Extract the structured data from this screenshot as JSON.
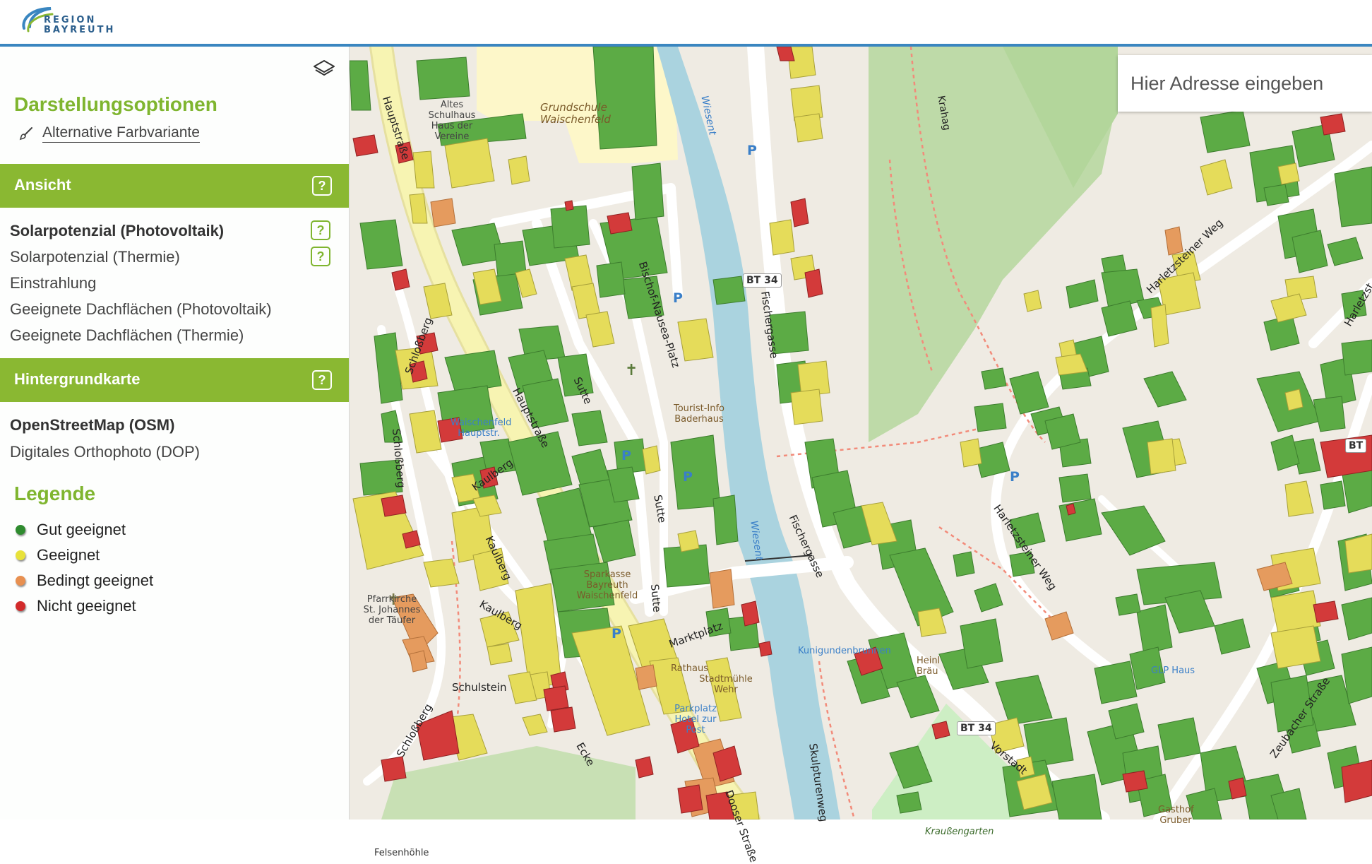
{
  "header": {
    "logo_line1": "REGION",
    "logo_line2": "BAYREUTH"
  },
  "search": {
    "placeholder": "Hier Adresse eingeben"
  },
  "sidebar": {
    "display_title": "Darstellungsoptionen",
    "alt_color_label": "Alternative Farbvariante",
    "view_band": {
      "label": "Ansicht",
      "help": "?"
    },
    "view_options": [
      {
        "label": "Solarpotenzial (Photovoltaik)",
        "active": true,
        "help": "?"
      },
      {
        "label": "Solarpotenzial (Thermie)",
        "active": false,
        "help": "?"
      },
      {
        "label": "Einstrahlung",
        "active": false
      },
      {
        "label": "Geeignete Dachflächen (Photovoltaik)",
        "active": false
      },
      {
        "label": "Geeignete Dachflächen (Thermie)",
        "active": false
      }
    ],
    "basemap_band": {
      "label": "Hintergrundkarte",
      "help": "?"
    },
    "basemap_options": [
      {
        "label": "OpenStreetMap (OSM)",
        "active": true
      },
      {
        "label": "Digitales Orthophoto (DOP)",
        "active": false
      }
    ],
    "legend_title": "Legende",
    "legend": [
      {
        "label": "Gut geeignet",
        "color": "#2e8b2e"
      },
      {
        "label": "Geeignet",
        "color": "#e8e23a"
      },
      {
        "label": "Bedingt geeignet",
        "color": "#e89050"
      },
      {
        "label": "Nicht geeignet",
        "color": "#d22b2b"
      }
    ]
  },
  "map": {
    "colors": {
      "good": "#5cab45",
      "suitable": "#e5dc5a",
      "conditional": "#e59b5e",
      "unsuitable": "#d33a3a",
      "water": "#aad3df",
      "forest": "#b8d9a2",
      "school": "#fdf7c9",
      "road_main": "#f7f4b2"
    },
    "road_labels": [
      "Hauptstraße",
      "Schloßberg",
      "Kaulberg",
      "Sutte",
      "Bischof-Nausea-Platz",
      "Fischergasse",
      "Harletzsteiner Weg",
      "Marktplatz",
      "Vorstadt",
      "Zeubacher Straße",
      "Dooser Straße",
      "Ecke",
      "Schulstein",
      "Skulpturenweg",
      "Harletzst"
    ],
    "route_shields": [
      "BT 34",
      "BT 34",
      "BT"
    ],
    "place_labels": [
      "Grundschule Waischenfeld",
      "Altes Schulhaus Haus der Vereine",
      "Tourist-Info Baderhaus",
      "Pfarrkirche St. Johannes der Täufer",
      "Sparkasse Bayreuth Waischenfeld",
      "Rathaus",
      "Stadtmühle Wehr",
      "Kunigundenbrunnen",
      "Heinl Bräu",
      "Kraußengarten",
      "Felsenhöhle",
      "GLP Haus",
      "Gasthof Gruber",
      "Parkplatz Hotel zur Post",
      "Waischenfeld Hauptstr.",
      "Wiesent",
      "Krahag"
    ]
  }
}
